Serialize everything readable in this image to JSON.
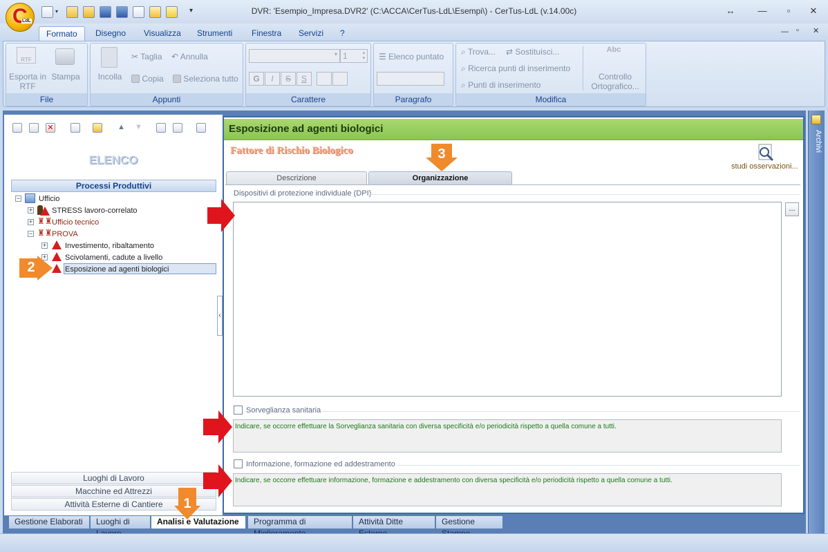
{
  "window": {
    "title": "DVR: 'Esempio_Impresa.DVR2'   (C:\\ACCA\\CerTus-LdL\\Esempi\\) - CerTus-LdL (v.14.00c)",
    "app_logo_letter": "C",
    "app_logo_sub": "LdL"
  },
  "ribbon_tabs": [
    "Formato",
    "Disegno",
    "Visualizza",
    "Strumenti",
    "Finestra",
    "Servizi",
    "?"
  ],
  "ribbon": {
    "file": {
      "label": "File",
      "export_rtf": "Esporta in RTF",
      "rtf_icon": "RTF",
      "print": "Stampa"
    },
    "appunti": {
      "label": "Appunti",
      "paste": "Incolla",
      "cut": "Taglia",
      "undo": "Annulla",
      "copy": "Copia",
      "select_all": "Seleziona tutto"
    },
    "carattere": {
      "label": "Carattere",
      "font_value": "",
      "size_value": "1",
      "bold": "G",
      "italic": "I",
      "strike": "S",
      "underline": "S"
    },
    "paragrafo": {
      "label": "Paragrafo",
      "bullet_list": "Elenco puntato"
    },
    "modifica": {
      "label": "Modifica",
      "find": "Trova...",
      "replace": "Sostituisci...",
      "search_insert": "Ricerca punti di inserimento",
      "insert_points": "Punti di inserimento",
      "spell": "Controllo Ortografico...",
      "spell_icon": "Abc"
    }
  },
  "left_panel": {
    "heading": "ELENCO",
    "section": "Processi Produttivi",
    "tree": {
      "root": "Ufficio",
      "items": [
        "STRESS lavoro-correlato",
        "Ufficio tecnico",
        "PROVA"
      ],
      "prova_children": [
        "Investimento, ribaltamento",
        "Scivolamenti, cadute a livello",
        "Esposizione ad agenti biologici"
      ]
    },
    "lower_bars": [
      "Luoghi di Lavoro",
      "Macchine ed Attrezzi",
      "Attività Esterne di Cantiere"
    ]
  },
  "bottom_tabs": [
    "Gestione Elaborati",
    "Luoghi di Lavoro",
    "Analisi e Valutazione",
    "Programma di Miglioramento",
    "Attività Ditte Esterne",
    "Gestione Stampe"
  ],
  "content": {
    "header": "Esposizione ad agenti biologici",
    "subtitle": "Fattore di Rischio Biologico",
    "studies_link": "studi osservazioni...",
    "tabs": [
      "Descrizione",
      "Organizzazione"
    ],
    "dpi_label": "Dispositivi di protezione individuale (DPI)",
    "browse_button": "...",
    "sorveglianza_label": "Sorveglianza sanitaria",
    "sorveglianza_note": "Indicare, se occorre effettuare la Sorveglianza sanitaria con diversa specificità e/o periodicità rispetto a quella comune a tutti.",
    "formazione_label": "Informazione, formazione ed addestramento",
    "formazione_note": "Indicare, se occorre effettuare informazione, formazione e addestramento con diversa specificità e/o periodicità rispetto a quella comune a tutti."
  },
  "archivi_label": "Archivi",
  "badges": [
    "1",
    "2",
    "3"
  ],
  "colors": {
    "accent_green": "#8cc553",
    "badge_orange": "#f08a2c",
    "arrow_red": "#e0141c",
    "frame_blue": "#5a7fb5"
  }
}
